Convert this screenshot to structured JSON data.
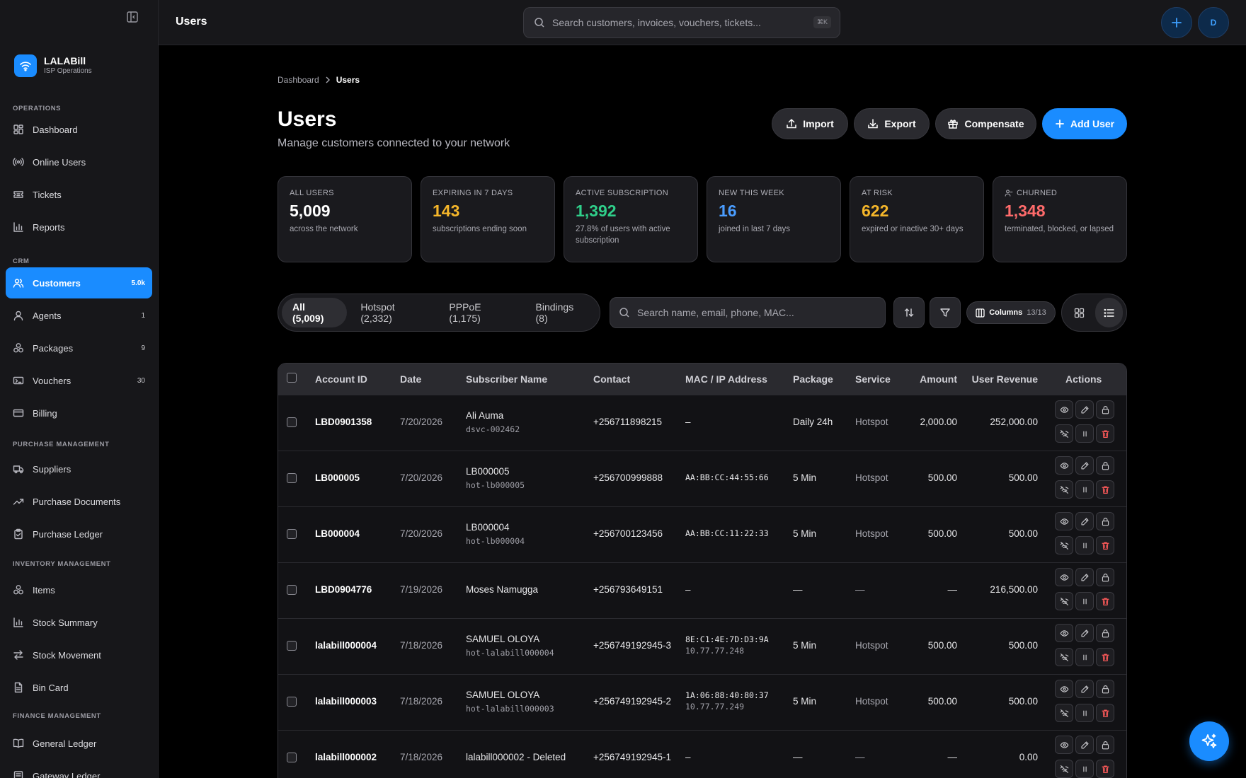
{
  "app": {
    "name": "LALABill",
    "subtitle": "ISP Operations"
  },
  "sidebar": {
    "sections": [
      {
        "label": "Operations"
      },
      {
        "label": "CRM"
      },
      {
        "label": "Purchase Management"
      },
      {
        "label": "Inventory Management"
      },
      {
        "label": "Finance Management"
      }
    ],
    "items": [
      {
        "label": "Dashboard",
        "icon": "dashboard-icon"
      },
      {
        "label": "Online Users",
        "icon": "broadcast-icon"
      },
      {
        "label": "Tickets",
        "icon": "ticket-icon"
      },
      {
        "label": "Reports",
        "icon": "bar-chart-icon"
      },
      {
        "label": "Customers",
        "icon": "users-icon",
        "count": "5.0k",
        "active": true
      },
      {
        "label": "Agents",
        "icon": "user-icon",
        "count": "1"
      },
      {
        "label": "Packages",
        "icon": "packages-icon",
        "count": "9"
      },
      {
        "label": "Vouchers",
        "icon": "voucher-icon",
        "count": "30"
      },
      {
        "label": "Billing",
        "icon": "credit-card-icon"
      },
      {
        "label": "Suppliers",
        "icon": "truck-icon"
      },
      {
        "label": "Purchase Documents",
        "icon": "trending-up-icon"
      },
      {
        "label": "Purchase Ledger",
        "icon": "clipboard-icon"
      },
      {
        "label": "Items",
        "icon": "boxes-icon"
      },
      {
        "label": "Stock Summary",
        "icon": "bar-chart-icon"
      },
      {
        "label": "Stock Movement",
        "icon": "arrows-icon"
      },
      {
        "label": "Bin Card",
        "icon": "file-icon"
      },
      {
        "label": "General Ledger",
        "icon": "book-icon"
      },
      {
        "label": "Gateway Ledger",
        "icon": "ledger-icon"
      }
    ]
  },
  "topbar": {
    "title": "Users",
    "search_placeholder": "Search customers, invoices, vouchers, tickets...",
    "shortcut": "⌘K",
    "avatar_initial": "D"
  },
  "breadcrumb": {
    "root": "Dashboard",
    "current": "Users"
  },
  "header": {
    "title": "Users",
    "subtitle": "Manage customers connected to your network",
    "buttons": {
      "import": "Import",
      "export": "Export",
      "compensate": "Compensate",
      "add_user": "Add User"
    }
  },
  "stats": [
    {
      "label": "All Users",
      "value": "5,009",
      "desc": "across the network",
      "color": "#ffffff"
    },
    {
      "label": "Expiring in 7 days",
      "value": "143",
      "desc": "subscriptions ending soon",
      "color": "#f5b62a"
    },
    {
      "label": "Active Subscription",
      "value": "1,392",
      "desc": "27.8% of users with active subscription",
      "color": "#2fcf8a"
    },
    {
      "label": "New this week",
      "value": "16",
      "desc": "joined in last 7 days",
      "color": "#4a9dff"
    },
    {
      "label": "At Risk",
      "value": "622",
      "desc": "expired or inactive 30+ days",
      "color": "#f5b62a"
    },
    {
      "label": "Churned",
      "value": "1,348",
      "desc": "terminated, blocked, or lapsed",
      "color": "#ff6b6b"
    }
  ],
  "filters": {
    "tabs": [
      "All (5,009)",
      "Hotspot (2,332)",
      "PPPoE (1,175)",
      "Bindings (8)"
    ],
    "search_placeholder": "Search name, email, phone, MAC...",
    "columns_label": "Columns",
    "columns_count": "13/13"
  },
  "table": {
    "columns": [
      "Account ID",
      "Date",
      "Subscriber Name",
      "Contact",
      "MAC / IP Address",
      "Package",
      "Service",
      "Amount",
      "User Revenue",
      "Actions"
    ],
    "rows": [
      {
        "account": "LBD0901358",
        "date": "7/20/2026",
        "name": "Ali Auma",
        "username": "dsvc-002462",
        "contact": "+256711898215",
        "mac": "–",
        "ip": "",
        "package": "Daily 24h",
        "service": "Hotspot",
        "amount": "2,000.00",
        "revenue": "252,000.00"
      },
      {
        "account": "LB000005",
        "date": "7/20/2026",
        "name": "LB000005",
        "username": "hot-lb000005",
        "contact": "+256700999888",
        "mac": "AA:BB:CC:44:55:66",
        "ip": "",
        "package": "5 Min",
        "service": "Hotspot",
        "amount": "500.00",
        "revenue": "500.00"
      },
      {
        "account": "LB000004",
        "date": "7/20/2026",
        "name": "LB000004",
        "username": "hot-lb000004",
        "contact": "+256700123456",
        "mac": "AA:BB:CC:11:22:33",
        "ip": "",
        "package": "5 Min",
        "service": "Hotspot",
        "amount": "500.00",
        "revenue": "500.00"
      },
      {
        "account": "LBD0904776",
        "date": "7/19/2026",
        "name": "Moses Namugga",
        "username": "",
        "contact": "+256793649151",
        "mac": "–",
        "ip": "",
        "package": "—",
        "service": "—",
        "amount": "—",
        "revenue": "216,500.00"
      },
      {
        "account": "lalabill000004",
        "date": "7/18/2026",
        "name": "SAMUEL OLOYA",
        "username": "hot-lalabill000004",
        "contact": "+256749192945-3",
        "mac": "8E:C1:4E:7D:D3:9A",
        "ip": "10.77.77.248",
        "package": "5 Min",
        "service": "Hotspot",
        "amount": "500.00",
        "revenue": "500.00"
      },
      {
        "account": "lalabill000003",
        "date": "7/18/2026",
        "name": "SAMUEL OLOYA",
        "username": "hot-lalabill000003",
        "contact": "+256749192945-2",
        "mac": "1A:06:88:40:80:37",
        "ip": "10.77.77.249",
        "package": "5 Min",
        "service": "Hotspot",
        "amount": "500.00",
        "revenue": "500.00"
      },
      {
        "account": "lalabill000002",
        "date": "7/18/2026",
        "name": "lalabill000002 - Deleted",
        "username": "",
        "contact": "+256749192945-1",
        "mac": "–",
        "ip": "",
        "package": "—",
        "service": "—",
        "amount": "—",
        "revenue": "0.00"
      }
    ]
  },
  "colors": {
    "accent": "#1a8cff",
    "danger": "#ff5a5a",
    "background": "#000000",
    "panel": "#17171a"
  }
}
